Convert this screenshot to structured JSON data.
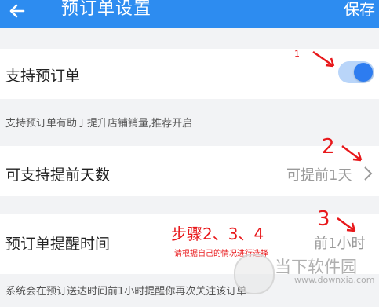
{
  "header": {
    "title": "预订单设置",
    "save_label": "保存"
  },
  "settings": {
    "support_preorder": {
      "label": "支持预订单",
      "enabled": true
    },
    "support_note": "支持预订单有助于提升店铺销量,推荐开启",
    "advance_days": {
      "label": "可支持提前天数",
      "value": "可提前1天"
    },
    "reminder_time": {
      "label": "预订单提醒时间",
      "value": "前1小时"
    },
    "reminder_note": "系统会在预订送达时间前1小时提醒你再次关注该订单"
  },
  "annotations": {
    "marker_1": "1",
    "marker_2": "2",
    "marker_3": "3",
    "steps_title": "步骤2、3、4",
    "steps_subtitle": "请根据自己的情况进行选择"
  },
  "watermark": {
    "text": "当下软件园",
    "url": "www.downxia.com"
  },
  "colors": {
    "header_bg": "#2d8cf0",
    "toggle_on": "#2d7cf0",
    "annotation_red": "#e8181b"
  },
  "icons": {
    "back": "arrow-left-icon",
    "chevron": "chevron-right-icon"
  }
}
